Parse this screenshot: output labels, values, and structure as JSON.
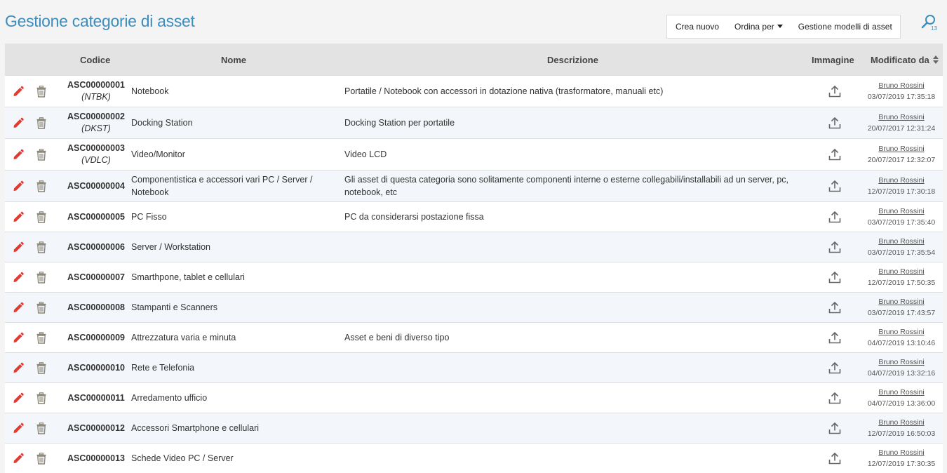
{
  "page": {
    "title": "Gestione categorie di asset"
  },
  "toolbar": {
    "create": "Crea nuovo",
    "sort": "Ordina per",
    "models": "Gestione modelli di asset"
  },
  "search": {
    "count": "13"
  },
  "table": {
    "headers": {
      "code": "Codice",
      "name": "Nome",
      "description": "Descrizione",
      "image": "Immagine",
      "modified": "Modificato da"
    },
    "rows": [
      {
        "code": "ASC00000001",
        "abbr": "(NTBK)",
        "name": "Notebook",
        "description": "Portatile / Notebook con accessori in dotazione nativa (trasformatore, manuali etc)",
        "user": "Bruno Rossini",
        "date": "03/07/2019 17:35:18"
      },
      {
        "code": "ASC00000002",
        "abbr": "(DKST)",
        "name": "Docking Station",
        "description": "Docking Station per portatile",
        "user": "Bruno Rossini",
        "date": "20/07/2017 12:31:24"
      },
      {
        "code": "ASC00000003",
        "abbr": "(VDLC)",
        "name": "Video/Monitor",
        "description": "Video LCD",
        "user": "Bruno Rossini",
        "date": "20/07/2017 12:32:07"
      },
      {
        "code": "ASC00000004",
        "abbr": "",
        "name": "Componentistica e accessori vari PC / Server / Notebook",
        "description": "Gli asset di questa categoria sono solitamente componenti interne o esterne collegabili/installabili ad un server, pc, notebook, etc",
        "user": "Bruno Rossini",
        "date": "12/07/2019 17:30:18"
      },
      {
        "code": "ASC00000005",
        "abbr": "",
        "name": "PC Fisso",
        "description": "PC da considerarsi postazione fissa",
        "user": "Bruno Rossini",
        "date": "03/07/2019 17:35:40"
      },
      {
        "code": "ASC00000006",
        "abbr": "",
        "name": "Server / Workstation",
        "description": "",
        "user": "Bruno Rossini",
        "date": "03/07/2019 17:35:54"
      },
      {
        "code": "ASC00000007",
        "abbr": "",
        "name": "Smarthpone, tablet e cellulari",
        "description": "",
        "user": "Bruno Rossini",
        "date": "12/07/2019 17:50:35"
      },
      {
        "code": "ASC00000008",
        "abbr": "",
        "name": "Stampanti e Scanners",
        "description": "",
        "user": "Bruno Rossini",
        "date": "03/07/2019 17:43:57"
      },
      {
        "code": "ASC00000009",
        "abbr": "",
        "name": "Attrezzatura varia e minuta",
        "description": "Asset e beni di diverso tipo",
        "user": "Bruno Rossini",
        "date": "04/07/2019 13:10:46"
      },
      {
        "code": "ASC00000010",
        "abbr": "",
        "name": "Rete e Telefonia",
        "description": "",
        "user": "Bruno Rossini",
        "date": "04/07/2019 13:32:16"
      },
      {
        "code": "ASC00000011",
        "abbr": "",
        "name": "Arredamento ufficio",
        "description": "",
        "user": "Bruno Rossini",
        "date": "04/07/2019 13:36:00"
      },
      {
        "code": "ASC00000012",
        "abbr": "",
        "name": "Accessori Smartphone e cellulari",
        "description": "",
        "user": "Bruno Rossini",
        "date": "12/07/2019 16:50:03"
      },
      {
        "code": "ASC00000013",
        "abbr": "",
        "name": "Schede Video PC / Server",
        "description": "",
        "user": "Bruno Rossini",
        "date": "12/07/2019 17:30:35"
      }
    ]
  },
  "icons": {
    "edit": "pencil-icon",
    "delete": "trash-icon",
    "image": "upload-icon",
    "sort": "sort-arrows-icon",
    "search": "search-icon"
  },
  "colors": {
    "title": "#3c8dbc",
    "edit": "#e03a32",
    "trash": "#8a8678",
    "header_bg": "#e3e3e3"
  }
}
